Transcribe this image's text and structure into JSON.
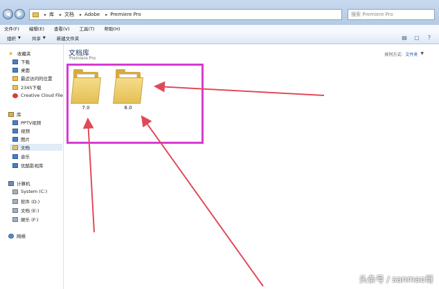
{
  "address": {
    "crumbs": [
      "库",
      "文档",
      "Adobe",
      "Premiere Pro"
    ],
    "search_placeholder": "搜索 Premiere Pro"
  },
  "menu": [
    "文件(F)",
    "编辑(E)",
    "查看(V)",
    "工具(T)",
    "帮助(H)"
  ],
  "toolbar": {
    "organize": "组织",
    "share": "共享",
    "new_folder": "新建文件夹"
  },
  "sidebar": {
    "favorites": {
      "label": "收藏夹",
      "items": [
        "下载",
        "桌面",
        "最近访问的位置",
        "2345下载",
        "Creative Cloud File"
      ]
    },
    "libraries": {
      "label": "库",
      "items": [
        "PPTV视频",
        "视频",
        "图片",
        "文档",
        "音乐",
        "优酷影视库"
      ],
      "selected": "文档"
    },
    "computer": {
      "label": "计算机",
      "items": [
        "System (C:)",
        "软件 (D:)",
        "文档 (E:)",
        "娱乐 (F:)"
      ]
    },
    "network": {
      "label": "网络"
    }
  },
  "content": {
    "title": "文档库",
    "subtitle": "Premiere Pro",
    "arrange_label": "排列方式:",
    "arrange_value": "文件夹",
    "folders": [
      "7.0",
      "8.0"
    ]
  },
  "annotation": {
    "highlight_color": "#d63bd1",
    "arrow_color": "#e04a58"
  },
  "watermark": "头条号 / sanmao哥"
}
